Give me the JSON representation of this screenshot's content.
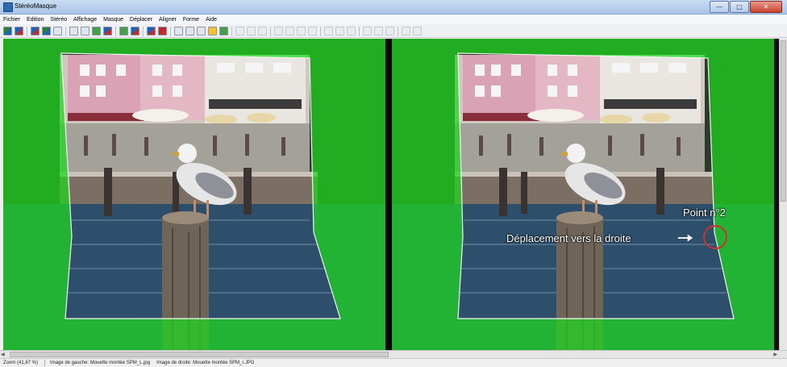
{
  "window": {
    "title": "StéréoMasque",
    "buttons": {
      "minimize": "—",
      "maximize": "□",
      "close": "✕"
    }
  },
  "menu": [
    "Fichier",
    "Edition",
    "Stéréo",
    "Affichage",
    "Masque",
    "Déplacer",
    "Aligner",
    "Forme",
    "Aide"
  ],
  "toolbar": {
    "icons": [
      "open-left-icon",
      "open-right-icon",
      "save-icon",
      "swap-icon",
      "align-icon",
      "crop-icon",
      "move-icon",
      "rotate-icon",
      "flip-icon",
      "mask-green-icon",
      "mask-clear-icon",
      "stereo-icon",
      "mark-icon",
      "point-add-icon",
      "shape-icon",
      "hand-icon",
      "zoom-in-icon",
      "zoom-out-icon",
      "grid-icon",
      "disabled-1",
      "disabled-2",
      "disabled-3",
      "disabled-4",
      "disabled-5",
      "disabled-6",
      "disabled-7",
      "disabled-8",
      "disabled-9",
      "disabled-10"
    ]
  },
  "annotations": {
    "point_label": "Point n°2",
    "move_label": "Déplacement vers la droite"
  },
  "status": {
    "zoom": "Zoom (41,67 %)",
    "left_image": "Image de gauche: Mouette montée SPM_L.jpg",
    "right_image": "Image de droite: Mouette montée SPM_r.JPG"
  },
  "colors": {
    "mask_green": "#1fd81f",
    "circle_red": "#d32f2f",
    "titlebar": "#b8cfee"
  }
}
